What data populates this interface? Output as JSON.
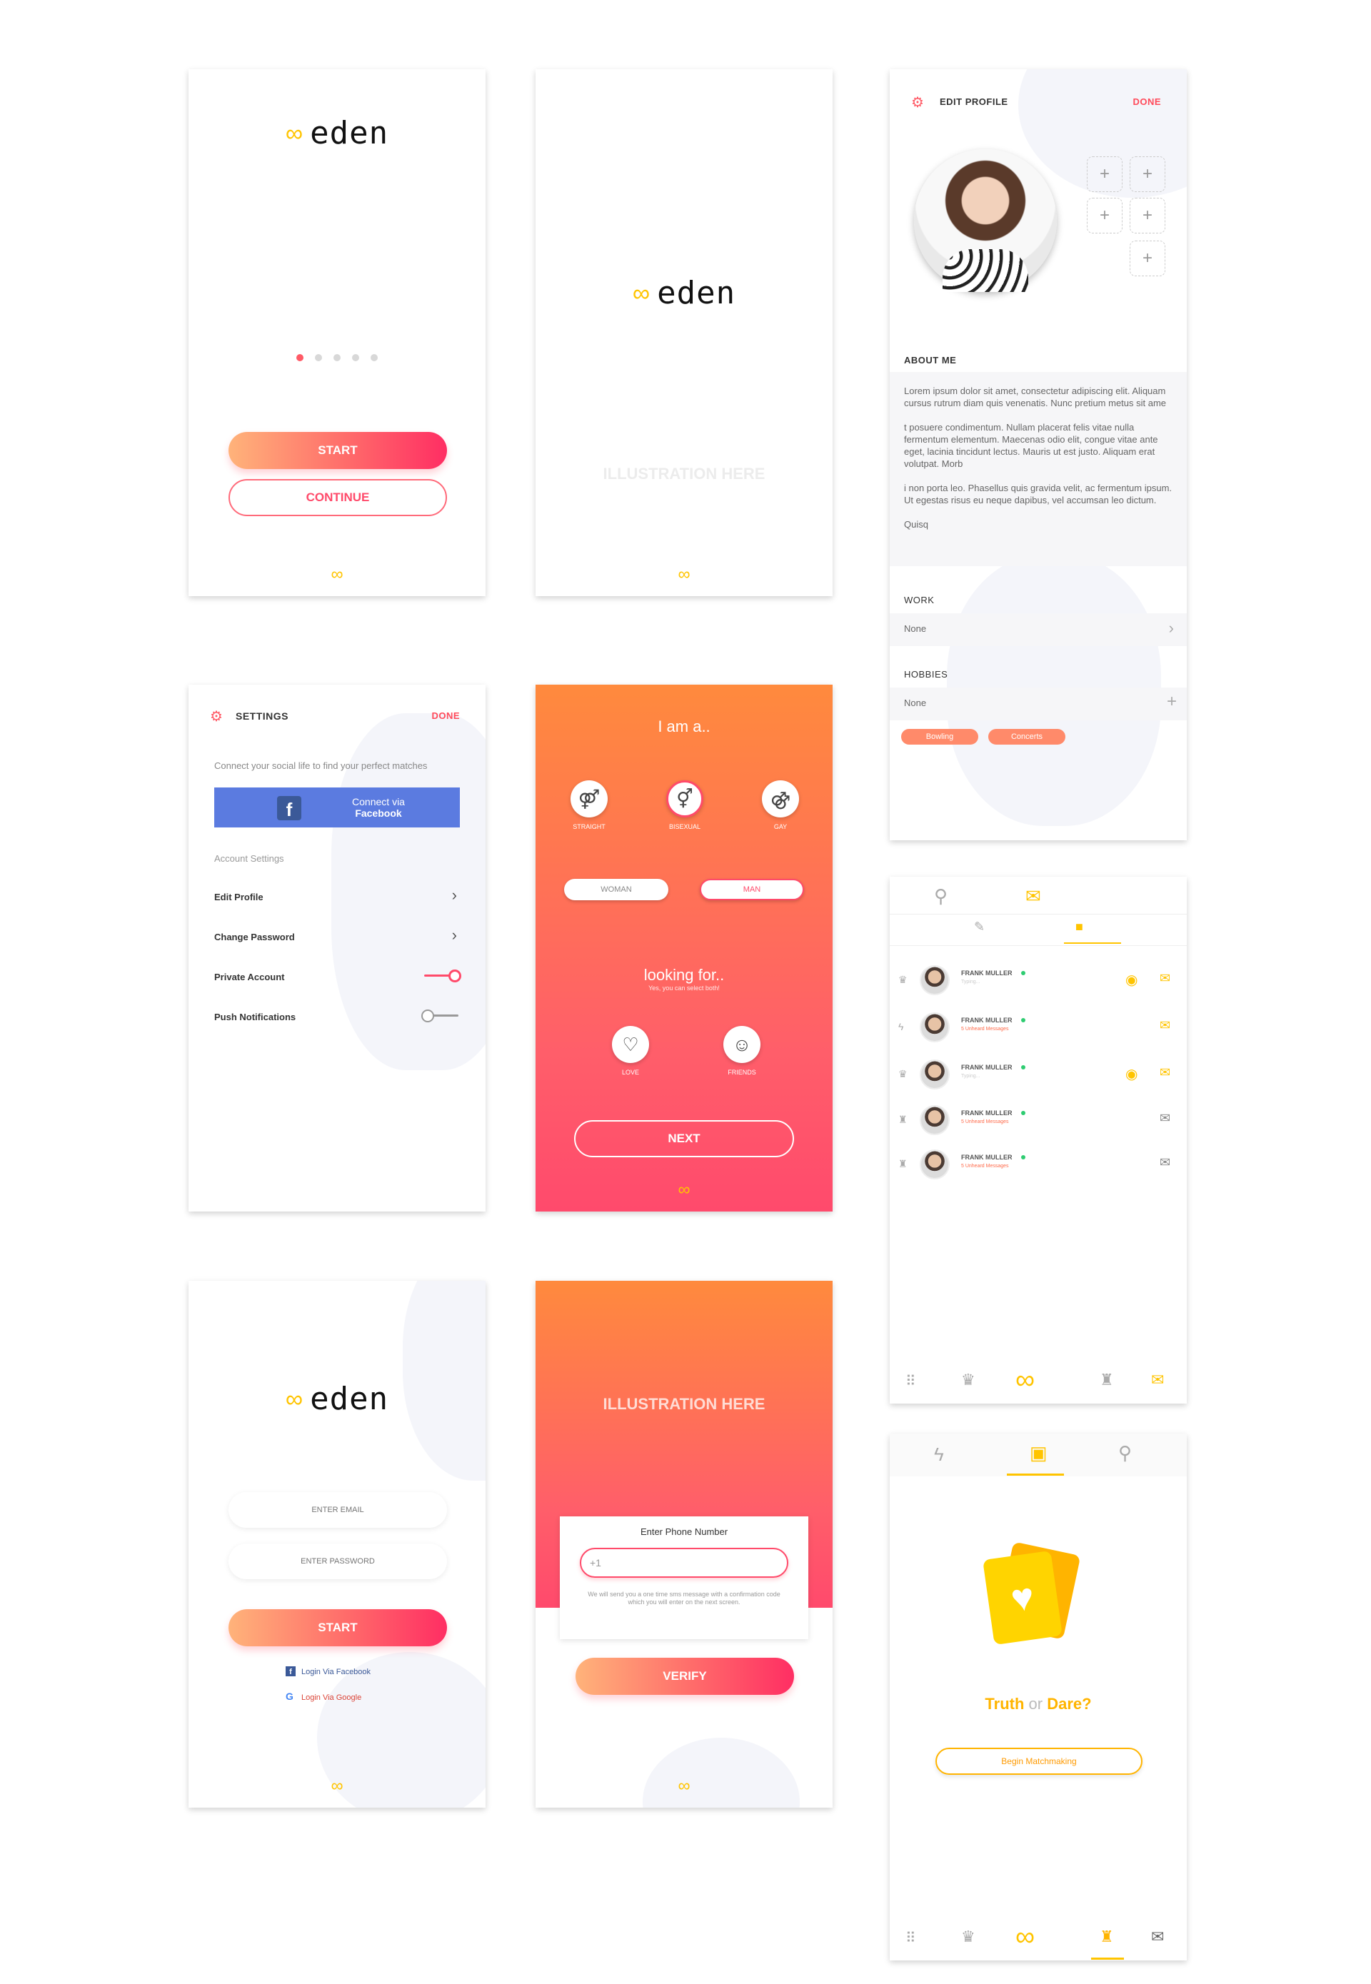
{
  "brand": {
    "logo_word": "eden",
    "infinity": "∞",
    "accent": "#ffc400",
    "primary": "#ff4a6a"
  },
  "welcome": {
    "start": "START",
    "continue": "CONTINUE",
    "pager_active_index": 0,
    "pager_total": 5
  },
  "splash": {
    "illustration": "ILLUSTRATION HERE"
  },
  "edit_profile": {
    "title": "EDIT PROFILE",
    "done": "DONE",
    "about_label": "ABOUT ME",
    "about_p1": "Lorem ipsum dolor sit amet, consectetur adipiscing elit. Aliquam cursus rutrum diam quis venenatis. Nunc pretium metus sit ame",
    "about_p2": "t posuere condimentum. Nullam placerat felis vitae nulla fermentum elementum. Maecenas odio elit, congue vitae ante eget, lacinia tincidunt lectus. Mauris ut est justo. Aliquam erat volutpat. Morb",
    "about_p3": "i non porta leo. Phasellus quis gravida velit, ac fermentum ipsum. Ut egestas risus eu neque dapibus, vel accumsan leo dictum.",
    "about_p4": "Quisq",
    "work_label": "WORK",
    "work_value": "None",
    "hobbies_label": "HOBBIES",
    "hobbies_value": "None",
    "tag1": "Bowling",
    "tag2": "Concerts"
  },
  "settings": {
    "title": "SETTINGS",
    "done": "DONE",
    "connect_text": "Connect your social life to find your perfect matches",
    "fb_line1": "Connect via",
    "fb_line2": "Facebook",
    "section": "Account Settings",
    "edit_profile": "Edit Profile",
    "change_password": "Change Password",
    "private_account": "Private Account",
    "push_notifications": "Push Notifications"
  },
  "orientation": {
    "title": "I am a..",
    "straight": "STRAIGHT",
    "bisexual": "BISEXUAL",
    "gay": "GAY",
    "woman": "WOMAN",
    "man": "MAN",
    "looking": "looking for..",
    "looking_sub": "Yes, you can select both!",
    "love": "LOVE",
    "friends": "FRIENDS",
    "next": "NEXT"
  },
  "messages": {
    "rows": [
      {
        "name": "FRANK MULLER",
        "sub": "Typing..."
      },
      {
        "name": "FRANK MULLER",
        "sub": "5 Unheard Messages"
      },
      {
        "name": "FRANK MULLER",
        "sub": "Typing..."
      },
      {
        "name": "FRANK MULLER",
        "sub": "5 Unheard Messages"
      },
      {
        "name": "FRANK MULLER",
        "sub": "5 Unheard Messages"
      }
    ]
  },
  "login": {
    "email_placeholder": "ENTER EMAIL",
    "password_placeholder": "ENTER PASSWORD",
    "start": "START",
    "facebook": "Login Via Facebook",
    "google": "Login Via Google"
  },
  "phone": {
    "illustration": "ILLUSTRATION HERE",
    "card_title": "Enter Phone Number",
    "input_value": "+1",
    "help": "We will send you a one time sms message with a confirmation code which you will enter on the next screen.",
    "verify": "VERIFY"
  },
  "game": {
    "title_truth": "Truth",
    "title_or": "or",
    "title_dare": "Dare?",
    "button": "Begin Matchmaking"
  }
}
